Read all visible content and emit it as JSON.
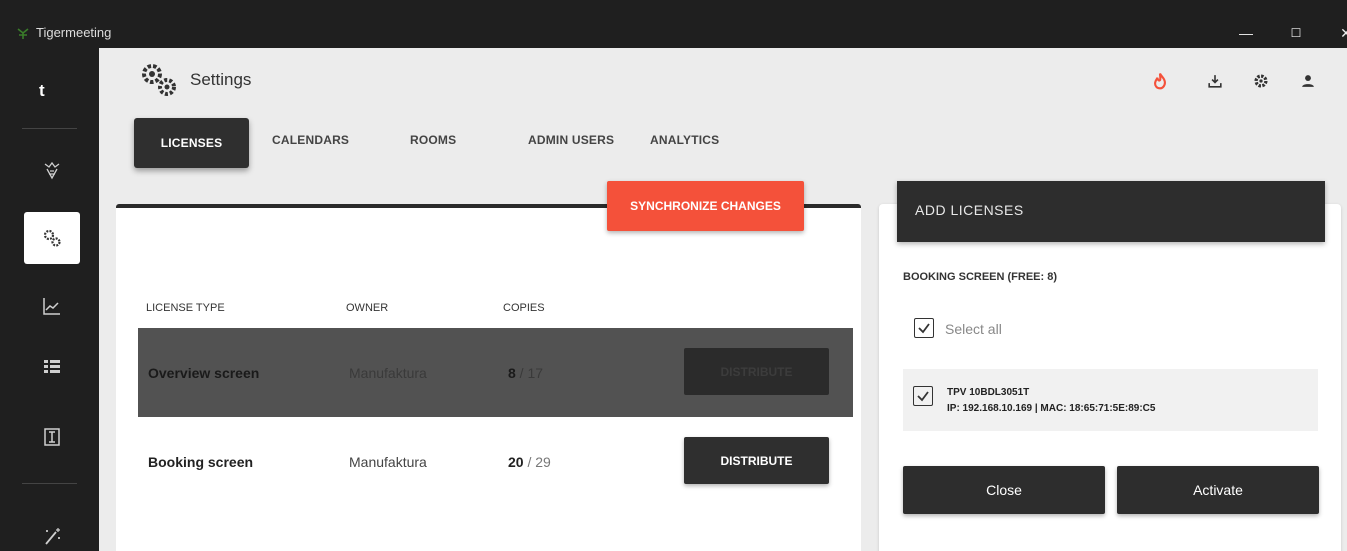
{
  "window": {
    "title": "Tigermeeting",
    "minimize": "—",
    "maximize": "☐",
    "close": "✕"
  },
  "sidebar": {
    "brand": "t",
    "items": [
      {
        "icon": "tiger-icon",
        "active": false
      },
      {
        "icon": "settings-icon",
        "active": true
      },
      {
        "icon": "analytics-chart-icon",
        "active": false
      },
      {
        "icon": "list-icon",
        "active": false
      },
      {
        "icon": "text-cursor-icon",
        "active": false
      },
      {
        "icon": "magic-wand-icon",
        "active": false
      }
    ]
  },
  "header": {
    "title": "Settings",
    "icons": [
      "fire-icon",
      "download-icon",
      "gear-icon",
      "user-icon"
    ],
    "accent_color": "#f4513a"
  },
  "tabs": [
    {
      "label": "LICENSES",
      "active": true
    },
    {
      "label": "CALENDARS",
      "active": false
    },
    {
      "label": "ROOMS",
      "active": false
    },
    {
      "label": "ADMIN USERS",
      "active": false
    },
    {
      "label": "ANALYTICS",
      "active": false
    }
  ],
  "licenses": {
    "sync_label": "SYNCHRONIZE CHANGES",
    "columns": [
      "LICENSE TYPE",
      "OWNER",
      "COPIES"
    ],
    "rows": [
      {
        "type": "Overview screen",
        "owner": "Manufaktura",
        "used": "8",
        "total": " / 17",
        "action": "DISTRIBUTE",
        "selected": true
      },
      {
        "type": "Booking screen",
        "owner": "Manufaktura",
        "used": "20",
        "total": " / 29",
        "action": "DISTRIBUTE",
        "selected": false
      }
    ]
  },
  "add_panel": {
    "title": "ADD LICENSES",
    "section": "BOOKING SCREEN (FREE: 8)",
    "select_all": "Select all",
    "device": {
      "name": "TPV 10BDL3051T",
      "info": "IP: 192.168.10.169 | MAC: 18:65:71:5E:89:C5",
      "checked": true
    },
    "close_label": "Close",
    "activate_label": "Activate"
  }
}
